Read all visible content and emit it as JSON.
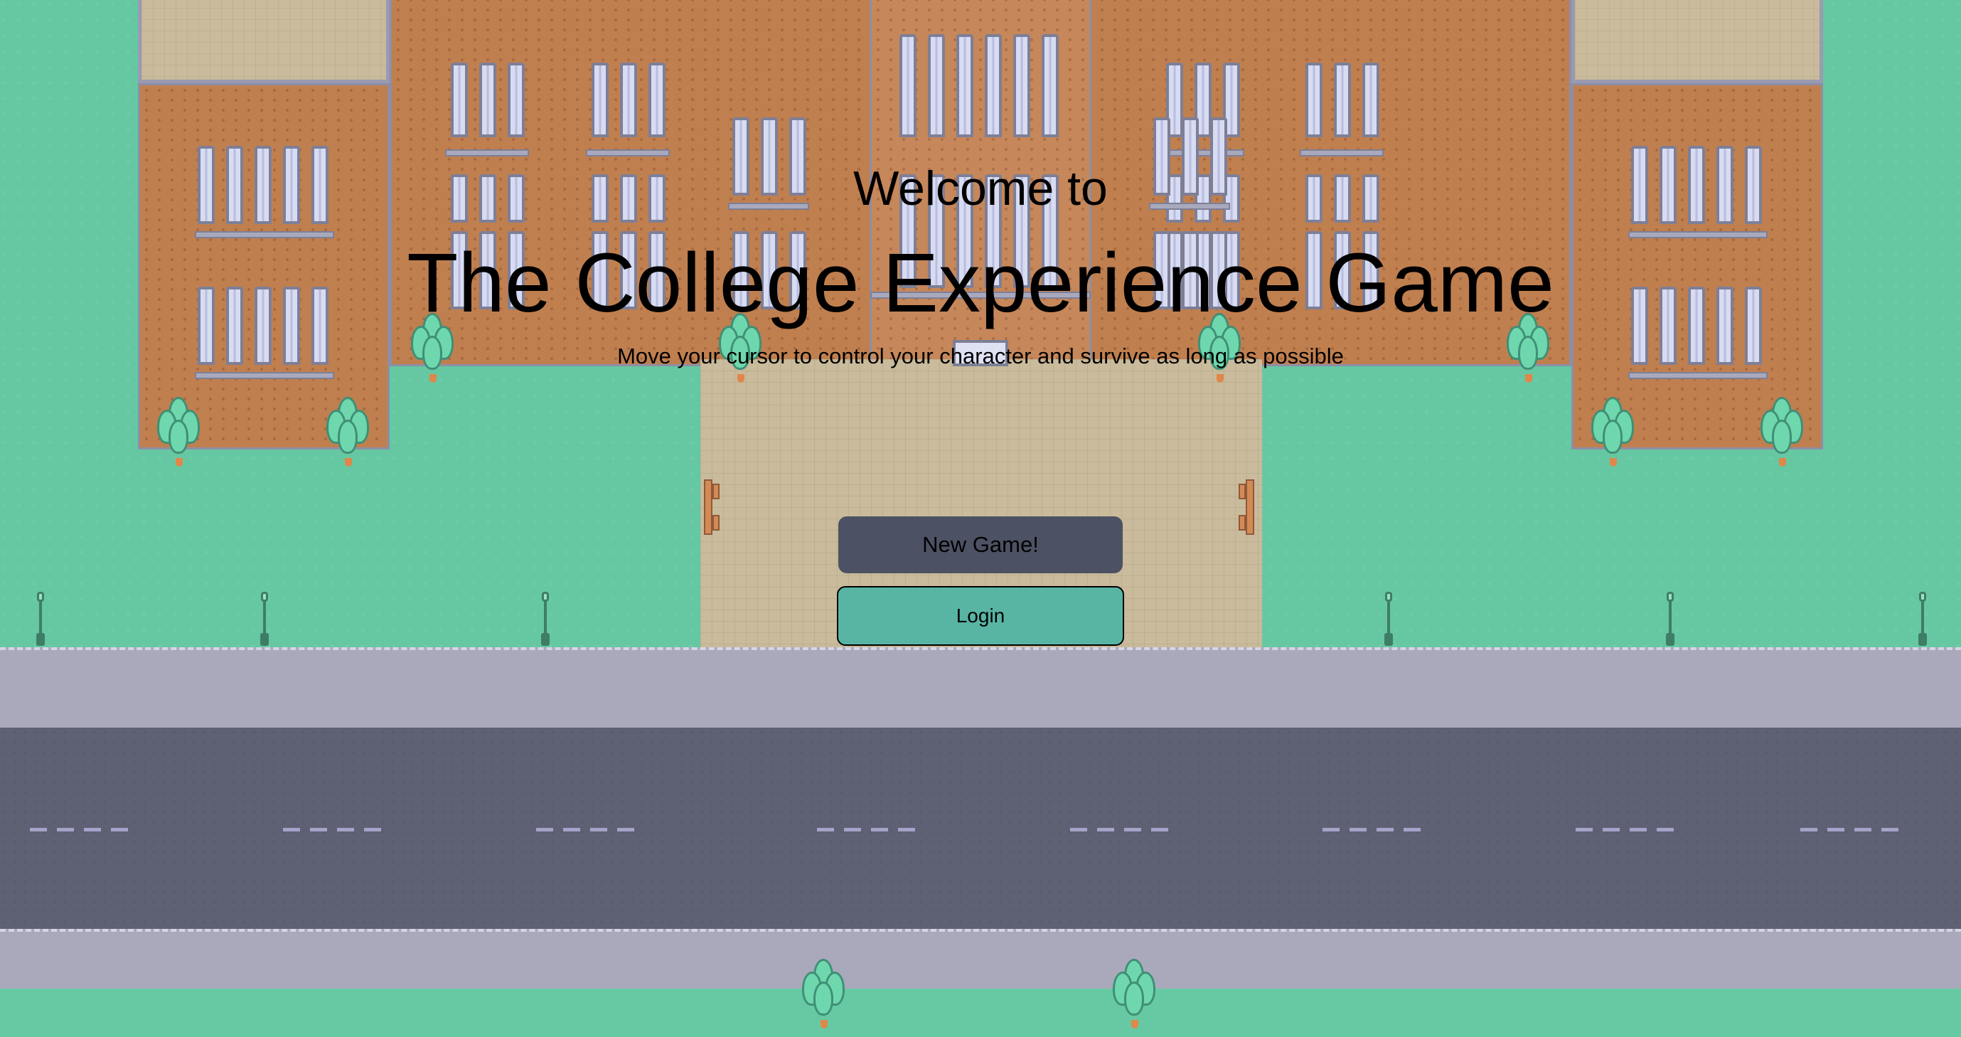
{
  "welcome_text": "Welcome to",
  "title": "The College Experience Game",
  "instructions": "Move your cursor to control your character and survive as long as possible",
  "buttons": {
    "new_game": "New Game!",
    "login": "Login"
  },
  "colors": {
    "grass": "#66c8a2",
    "brick": "#c07f4f",
    "new_game_button": "#4c5263",
    "login_button": "#58b5a3",
    "road": "#5e6174",
    "sidewalk": "#aaa9bb"
  }
}
